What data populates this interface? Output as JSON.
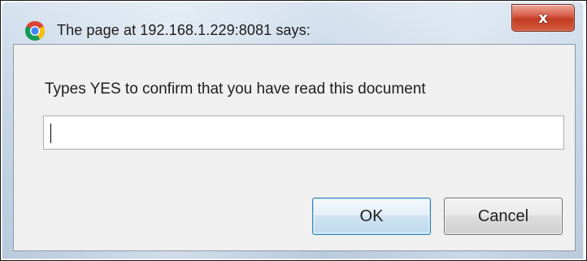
{
  "dialog": {
    "title": "The page at 192.168.1.229:8081 says:",
    "close_label": "x",
    "title_icon": "chrome-browser-icon",
    "message": "Types YES to confirm that you have read this document",
    "input": {
      "value": "",
      "placeholder": ""
    },
    "ok_label": "OK",
    "cancel_label": "Cancel"
  },
  "colors": {
    "close_button": "#c13b22",
    "ok_border": "#3c7fb1",
    "client_background": "#f0f0f0"
  }
}
